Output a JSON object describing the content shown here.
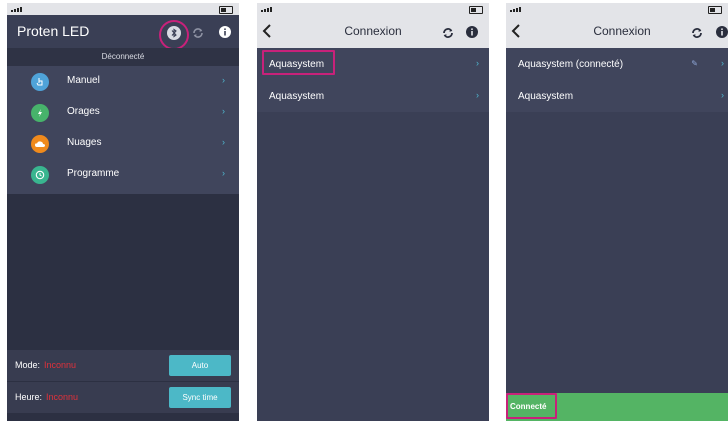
{
  "colors": {
    "accent": "#4cb8c7",
    "highlight": "#c8217a",
    "error": "#e0313b",
    "success": "#54b464"
  },
  "screen1": {
    "title": "Proten LED",
    "status": "Déconnecté",
    "menu": [
      {
        "label": "Manuel",
        "icon": "hand-pointer-icon",
        "color": "#4fa3d9"
      },
      {
        "label": "Orages",
        "icon": "lightning-icon",
        "color": "#47b36b"
      },
      {
        "label": "Nuages",
        "icon": "cloud-icon",
        "color": "#f08a1c"
      },
      {
        "label": "Programme",
        "icon": "clock-icon",
        "color": "#39b58f"
      }
    ],
    "mode": {
      "label": "Mode:",
      "value": "Inconnu",
      "button": "Auto"
    },
    "heure": {
      "label": "Heure:",
      "value": "Inconnu",
      "button": "Sync time"
    }
  },
  "screen2": {
    "title": "Connexion",
    "devices": [
      "Aquasystem",
      "Aquasystem"
    ]
  },
  "screen3": {
    "title": "Connexion",
    "devices": [
      "Aquasystem (connecté)",
      "Aquasystem"
    ],
    "status": "Connecté"
  },
  "icons": {
    "refresh": "refresh-icon",
    "info": "info-icon",
    "back": "back-chevron-icon",
    "bluetooth": "bluetooth-icon",
    "chevron": "›"
  }
}
